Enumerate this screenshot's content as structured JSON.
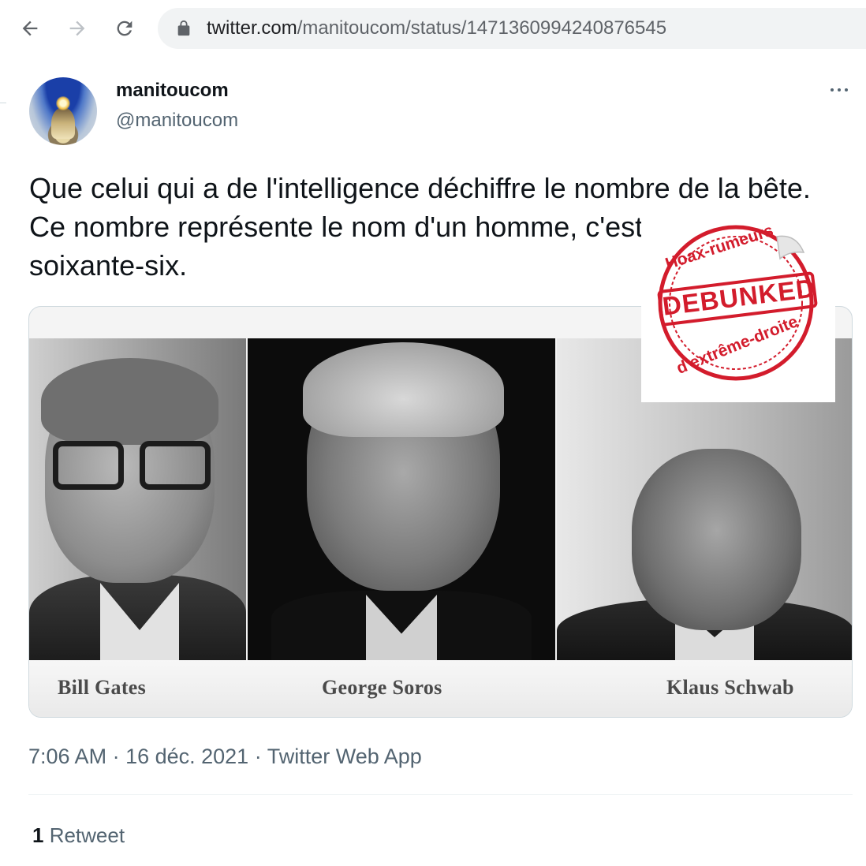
{
  "browser": {
    "url_host": "twitter.com",
    "url_path": "/manitoucom/status/1471360994240876545",
    "back_icon": "back-arrow-icon",
    "forward_icon": "forward-arrow-icon",
    "reload_icon": "reload-icon",
    "lock_icon": "lock-icon"
  },
  "tweet": {
    "display_name": "manitoucom",
    "handle": "@manitoucom",
    "text": "Que celui qui a de l'intelligence déchiffre le nombre de la bête. Ce nombre représente le nom d'un homme, c'est : six cent soixante-six.",
    "media": {
      "captions": [
        "Bill Gates",
        "George Soros",
        "Klaus Schwab"
      ]
    },
    "time": "7:06 AM",
    "date": "16 déc. 2021",
    "source": "Twitter Web App",
    "separator": " · ",
    "retweet_count": "1",
    "retweet_label": " Retweet"
  },
  "sticker": {
    "top_text": "Hoax-rumeurs",
    "title": "DEBUNKED",
    "bottom_text": "d'extrême-droite",
    "color": "#d31c2c"
  },
  "colors": {
    "text_primary": "#0f1419",
    "text_secondary": "#536471",
    "border": "#cfd9de"
  }
}
